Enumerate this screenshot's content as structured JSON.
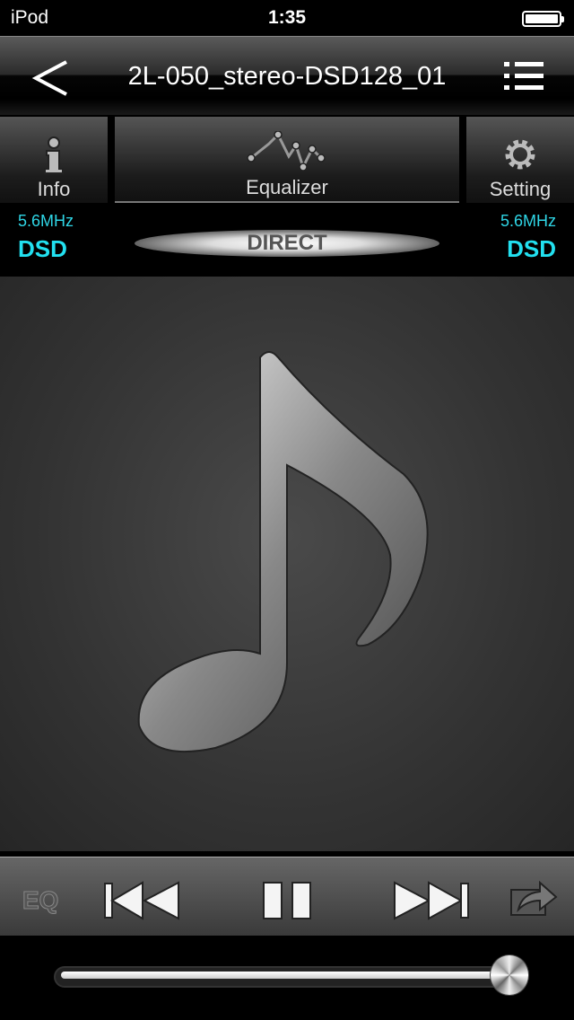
{
  "status": {
    "carrier": "iPod",
    "time": "1:35",
    "battery_level": 1.0
  },
  "nav": {
    "title": "2L-050_stereo-DSD128_01",
    "back_icon": "chevron-left-icon",
    "list_icon": "list-icon"
  },
  "tabs": [
    {
      "label": "Info",
      "icon": "info-icon"
    },
    {
      "label": "Equalizer",
      "icon": "equalizer-wave-icon"
    },
    {
      "label": "Setting",
      "icon": "gear-icon"
    }
  ],
  "format": {
    "left_freq": "5.6MHz",
    "left_type": "DSD",
    "right_freq": "5.6MHz",
    "right_type": "DSD",
    "mode": "DIRECT"
  },
  "artwork": {
    "icon": "music-note-icon"
  },
  "controls": {
    "eq_label": "EQ",
    "prev_icon": "skip-previous-icon",
    "pause_icon": "pause-icon",
    "next_icon": "skip-next-icon",
    "share_icon": "share-icon"
  },
  "slider": {
    "value": 1.0
  },
  "colors": {
    "accent": "#22e0f0"
  }
}
